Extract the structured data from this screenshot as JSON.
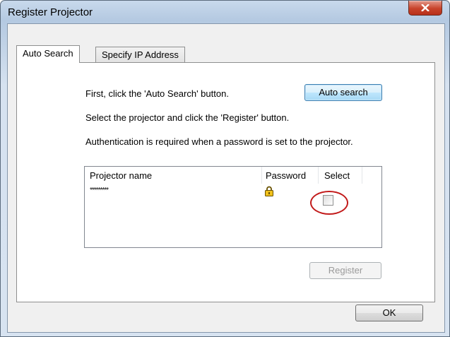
{
  "window": {
    "title": "Register Projector"
  },
  "tabs": [
    {
      "label": "Auto Search"
    },
    {
      "label": "Specify IP Address"
    }
  ],
  "auto_search": {
    "instruction_1": "First, click the 'Auto Search' button.",
    "auto_search_button": "Auto search",
    "instruction_2": "Select the projector and click the 'Register' button.",
    "instruction_3": "Authentication is required when a password is set to the projector."
  },
  "projector_list": {
    "columns": [
      "Projector name",
      "Password",
      "Select"
    ],
    "rows": [
      {
        "name": "*********",
        "password_icon": "lock-icon",
        "selected": false
      }
    ]
  },
  "register_button": "Register",
  "ok_button": "OK",
  "colors": {
    "highlight_ring": "#c21a1a",
    "close_button": "#c8432b"
  }
}
